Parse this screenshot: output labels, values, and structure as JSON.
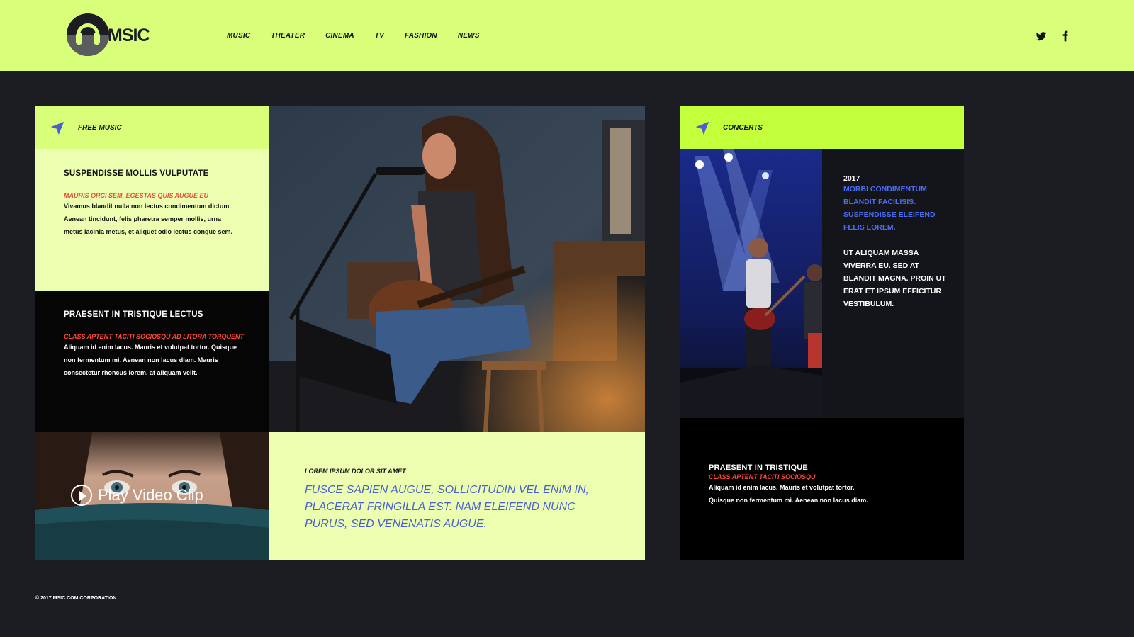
{
  "brand": {
    "logo_text": "MSIC",
    "accent": "#d9ff7a"
  },
  "nav": {
    "items": [
      {
        "label": "MUSIC"
      },
      {
        "label": "THEATER"
      },
      {
        "label": "CINEMA"
      },
      {
        "label": "TV"
      },
      {
        "label": "FASHION"
      },
      {
        "label": "NEWS"
      }
    ]
  },
  "social": {
    "icons": [
      "twitter-icon",
      "facebook-icon"
    ]
  },
  "free_music": {
    "header_label": "FREE MUSIC",
    "block1": {
      "title": "SUSPENDISSE MOLLIS VULPUTATE",
      "subtitle": "MAURIS ORCI SEM, EGESTAS QUIS AUGUE EU",
      "text": "Vivamus blandit nulla non lectus condimentum dictum. Aenean tincidunt, felis pharetra semper mollis, urna metus lacinia metus, et aliquet odio lectus congue sem."
    },
    "block2": {
      "title": "PRAESENT IN TRISTIQUE LECTUS",
      "subtitle": "CLASS APTENT TACITI SOCIOSQU AD LITORA TORQUENT",
      "text": "Aliquam id enim lacus. Mauris et volutpat tortor. Quisque non fermentum mi. Aenean non lacus diam. Mauris consectetur rhoncus lorem, at aliquam velit."
    },
    "video": {
      "label": "Play Video Clip"
    },
    "quote": {
      "label": "LOREM IPSUM DOLOR SIT AMET",
      "text": "FUSCE SAPIEN AUGUE, SOLLICITUDIN VEL ENIM IN, PLACERAT FRINGILLA EST. NAM ELEIFEND NUNC PURUS, SED VENENATIS AUGUE."
    }
  },
  "concerts": {
    "header_label": "CONCERTS",
    "year": "2017",
    "blue_text": "MORBI CONDIMENTUM BLANDIT FACILISIS. SUSPENDISSE ELEIFEND FELIS LOREM.",
    "white_text": "UT ALIQUAM MASSA VIVERRA EU. SED AT BLANDIT MAGNA. PROIN UT ERAT ET IPSUM EFFICITUR VESTIBULUM.",
    "block": {
      "title": "PRAESENT IN TRISTIQUE",
      "subtitle": "CLASS APTENT TACITI SOCIOSQU",
      "text": "Aliquam id enim lacus. Mauris et volutpat tortor. Quisque non fermentum mi. Aenean non lacus diam."
    }
  },
  "footer": {
    "copyright": "© 2017 MSIC.COM CORPORATION"
  }
}
